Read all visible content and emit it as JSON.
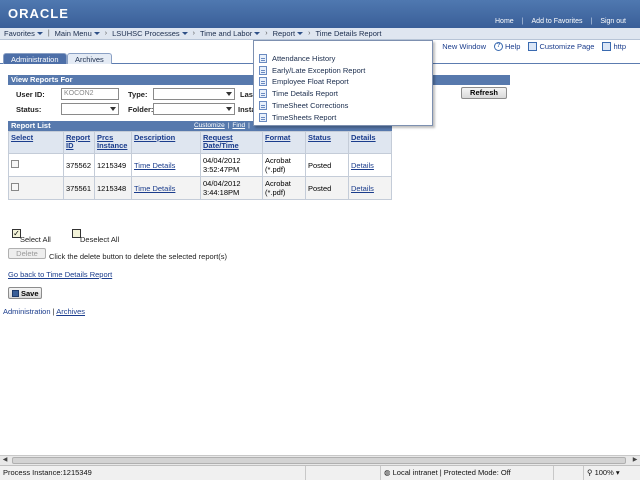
{
  "header": {
    "logo": "ORACLE",
    "links": [
      "Home",
      "Add to Favorites",
      "Sign out"
    ]
  },
  "nav": {
    "items": [
      "Favorites",
      "Main Menu",
      "LSUHSC Processes",
      "Time and Labor",
      "Report",
      "Time Details Report"
    ]
  },
  "tabs": [
    "Administration",
    "Archives"
  ],
  "right_links": {
    "new_window": "New Window",
    "help": "Help",
    "customize": "Customize Page",
    "http": "http"
  },
  "view_reports": {
    "title": "View Reports For",
    "user_id_label": "User ID:",
    "user_id_value": "KOCON2",
    "type_label": "Type:",
    "last_label": "Las",
    "status_label": "Status:",
    "folder_label": "Folder:",
    "instance_label": "Insta",
    "refresh_label": "Refresh"
  },
  "report_list": {
    "title": "Report List",
    "links": [
      "Customize",
      "Find"
    ],
    "columns": [
      "Select",
      "Report ID",
      "Prcs Instance",
      "Description",
      "Request Date/Time",
      "Format",
      "Status",
      "Details"
    ],
    "rows": [
      {
        "report_id": "375562",
        "instance": "1215349",
        "description": "Time Details",
        "datetime": "04/04/2012 3:52:47PM",
        "format": "Acrobat (*.pdf)",
        "status": "Posted",
        "details": "Details"
      },
      {
        "report_id": "375561",
        "instance": "1215348",
        "description": "Time Details",
        "datetime": "04/04/2012 3:44:18PM",
        "format": "Acrobat (*.pdf)",
        "status": "Posted",
        "details": "Details"
      }
    ]
  },
  "menu": {
    "items": [
      "Attendance History",
      "Early/Late Exception Report",
      "Employee Float Report",
      "Time Details Report",
      "TimeSheet Corrections",
      "TimeSheets Report"
    ]
  },
  "actions": {
    "select_all": "Select All",
    "deselect_all": "Deselect All",
    "delete_label": "Delete",
    "delete_hint": "Click the delete button to delete the selected report(s)",
    "go_back": "Go back to Time Details Report",
    "save_label": "Save"
  },
  "footer_links": [
    "Administration",
    "Archives"
  ],
  "statusbar": {
    "process": "Process Instance:1215349",
    "zone": "Local intranet | Protected Mode: Off",
    "zoom": "100%"
  },
  "colors": {
    "header_blue": "#4f78b0",
    "section_blue": "#5779ad",
    "link_blue": "#1a3c8c"
  }
}
